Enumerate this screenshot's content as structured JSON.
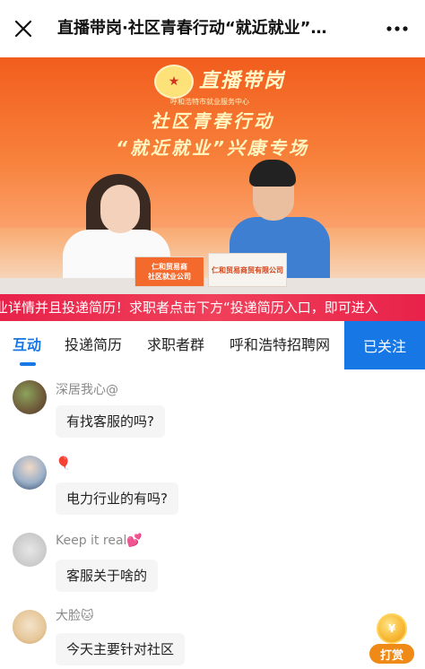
{
  "header": {
    "title": "直播带岗·社区青春行动“就近就业”…",
    "close_icon": "close-icon",
    "more_icon": "more-dots-icon"
  },
  "video": {
    "brand": "直播带岗",
    "brand_sub": "呼和浩特市就业服务中心",
    "headline_line1": "社区青春行动",
    "headline_line2": "“就近就业”兴康专场",
    "card_left": "仁和贸易商\n社区就业公司",
    "card_right": "仁和贸易商贸有限公司"
  },
  "marquee": {
    "text": "业详情并且投递简历！求职者点击下方“投递简历入口，即可进入"
  },
  "tabs": {
    "items": [
      {
        "label": "互动",
        "active": true
      },
      {
        "label": "投递简历",
        "active": false
      },
      {
        "label": "求职者群",
        "active": false
      },
      {
        "label": "呼和浩特招聘网",
        "active": false
      }
    ],
    "follow_label": "已关注"
  },
  "chat": {
    "messages": [
      {
        "user": "深居我心@",
        "text": "有找客服的吗?"
      },
      {
        "user": "🎈",
        "text": "电力行业的有吗?"
      },
      {
        "user": "Keep it real💕",
        "text": "客服关于啥的"
      },
      {
        "user": "大脸🐱",
        "text": "今天主要针对社区"
      }
    ]
  },
  "tip": {
    "label": "打赏",
    "coin_symbol": "¥"
  },
  "colors": {
    "accent_blue": "#1677e5",
    "marquee_red": "#e8224a",
    "tip_orange": "#ef8a17"
  }
}
